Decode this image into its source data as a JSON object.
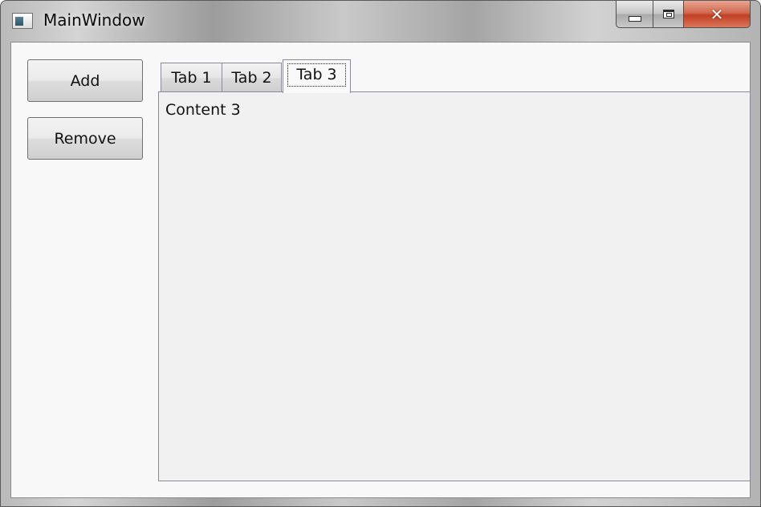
{
  "window": {
    "title": "MainWindow",
    "icon": "app-window-icon",
    "controls": {
      "minimize_icon": "minimize-icon",
      "maximize_icon": "maximize-icon",
      "close_icon": "close-icon",
      "close_glyph": "✕"
    }
  },
  "sidebar": {
    "add_label": "Add",
    "remove_label": "Remove"
  },
  "tabs": [
    {
      "label": "Tab 1",
      "selected": false
    },
    {
      "label": "Tab 2",
      "selected": false
    },
    {
      "label": "Tab 3",
      "selected": true
    }
  ],
  "panel": {
    "content": "Content 3"
  },
  "colors": {
    "close_button": "#c94a2e",
    "client_background": "#f8f8f8",
    "panel_background": "#f1f1f1"
  }
}
